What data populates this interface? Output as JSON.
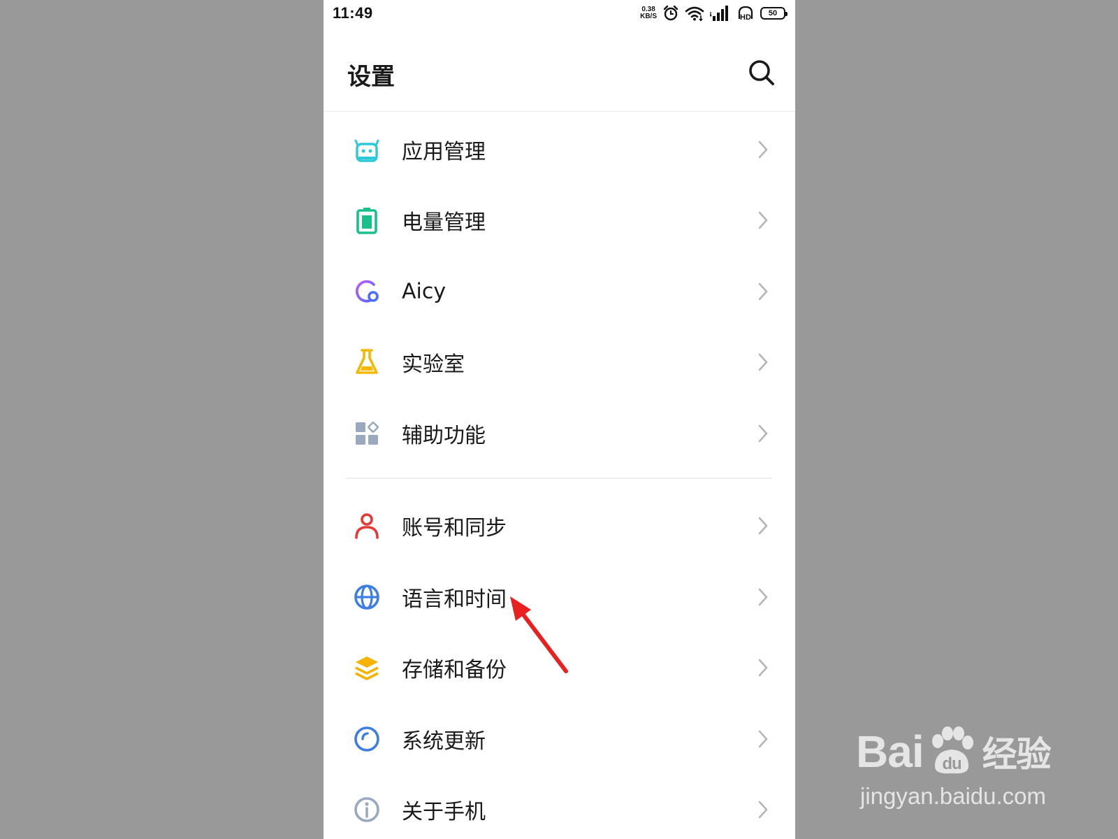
{
  "status_bar": {
    "time": "11:49",
    "net_speed_value": "0.38",
    "net_speed_unit": "KB/S",
    "network_type": "4G",
    "hd_label": "HD",
    "battery": "50"
  },
  "header": {
    "title": "设置",
    "search_icon": "search-icon"
  },
  "groups": [
    {
      "items": [
        {
          "label": "应用管理",
          "icon": "android-app-icon",
          "color": "#2ec9d6"
        },
        {
          "label": "电量管理",
          "icon": "battery-icon",
          "color": "#19c08a"
        },
        {
          "label": "Aicy",
          "icon": "aicy-icon",
          "color": "#8a5cf6"
        },
        {
          "label": "实验室",
          "icon": "flask-icon",
          "color": "#f5b800"
        },
        {
          "label": "辅助功能",
          "icon": "grid-icon",
          "color": "#9aa9bf"
        }
      ]
    },
    {
      "items": [
        {
          "label": "账号和同步",
          "icon": "user-icon",
          "color": "#e53935"
        },
        {
          "label": "语言和时间",
          "icon": "globe-icon",
          "color": "#3d7ee6"
        },
        {
          "label": "存储和备份",
          "icon": "layers-icon",
          "color": "#f5b300"
        },
        {
          "label": "系统更新",
          "icon": "update-icon",
          "color": "#3d7ee6"
        },
        {
          "label": "关于手机",
          "icon": "info-icon",
          "color": "#9aa9bf"
        }
      ]
    }
  ],
  "annotation": {
    "arrow_color": "#e82020"
  },
  "watermark": {
    "brand_left": "Bai",
    "brand_right": "经验",
    "url": "jingyan.baidu.com"
  }
}
